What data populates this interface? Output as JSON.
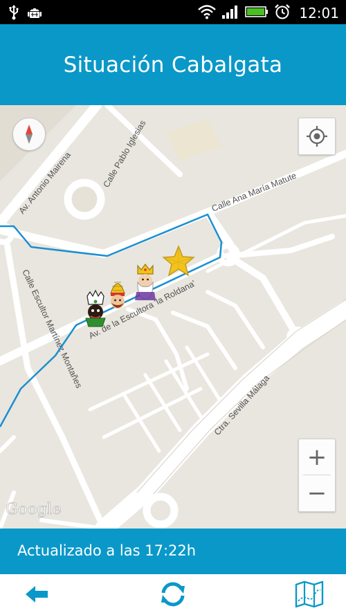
{
  "status_bar": {
    "time": "12:01"
  },
  "app_bar": {
    "title": "Situación Cabalgata"
  },
  "map": {
    "streets": {
      "av_antonio_mairena": "Av. Antonio Mairena",
      "calle_pablo_iglesias": "Calle Pablo Iglesias",
      "calle_ana_maria_matute": "Calle Ana María Matute",
      "av_escultora_roldana": "Av. de la Escultora 'la Roldana'",
      "calle_escultor_martinez_montanes": "Calle Escultor Martínez Montañes",
      "ctra_sevilla_malaga": "Ctra. Sevilla Málaga"
    },
    "zoom_in_label": "+",
    "zoom_out_label": "−",
    "attribution": "Google",
    "route_color": "#1a8fd0"
  },
  "update_bar": {
    "text": "Actualizado a las 17:22h"
  },
  "accent_color": "#0a98c8",
  "bottom_nav": {
    "items": [
      "back-arrow-icon",
      "refresh-icon",
      "map-icon"
    ]
  }
}
